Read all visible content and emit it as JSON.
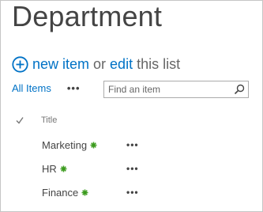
{
  "page": {
    "title": "Department"
  },
  "command": {
    "new_item": "new item",
    "or": "or",
    "edit": "edit",
    "this_list": "this list"
  },
  "views": {
    "current": "All Items",
    "more": "•••"
  },
  "search": {
    "placeholder": "Find an item",
    "value": ""
  },
  "list": {
    "columns": [
      {
        "label": "Title"
      }
    ],
    "rows": [
      {
        "title": "Marketing",
        "more": "•••"
      },
      {
        "title": "HR",
        "more": "•••"
      },
      {
        "title": "Finance",
        "more": "•••"
      }
    ]
  },
  "colors": {
    "accent": "#0072c6",
    "new_badge": "#3a9a1c",
    "text": "#444444"
  },
  "icons": {
    "add": "plus-circle-icon",
    "search": "search-icon",
    "select": "checkmark-icon",
    "new_badge": "new-item-icon"
  }
}
